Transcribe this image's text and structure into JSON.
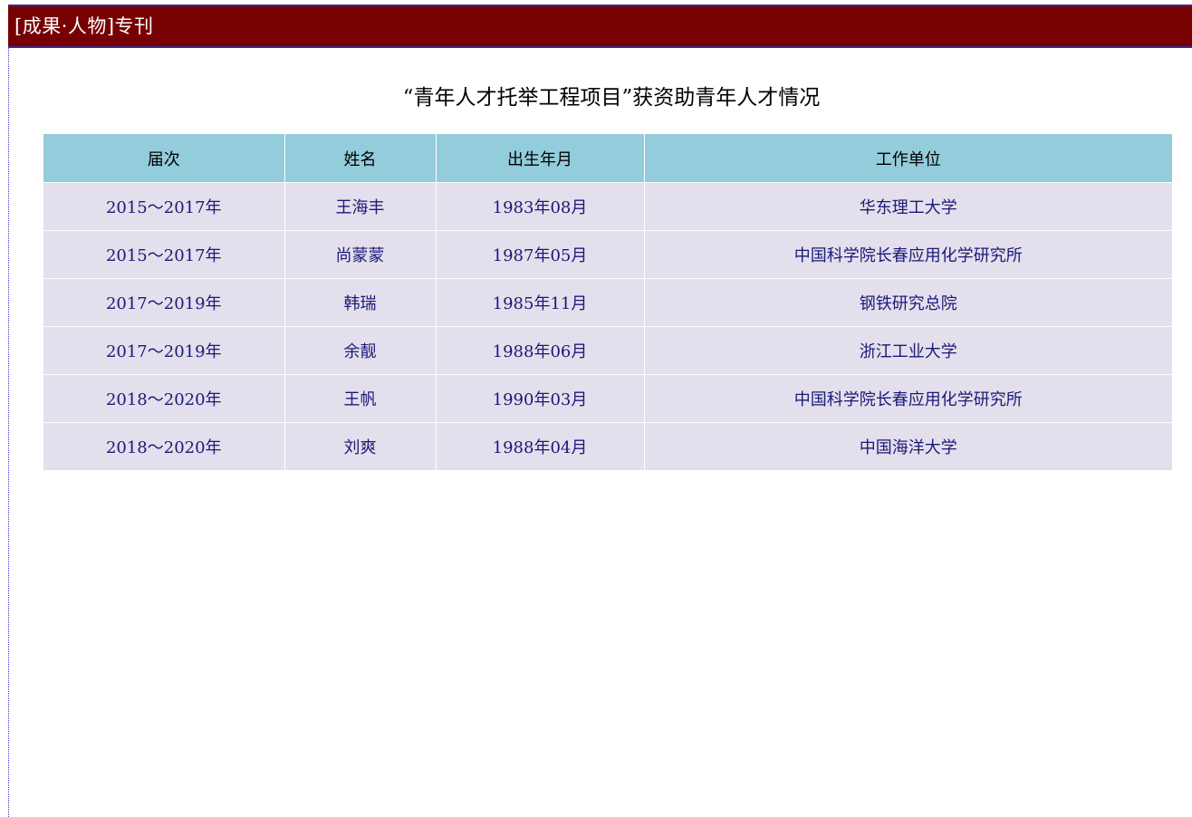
{
  "header": {
    "title": "[成果·人物]专刊"
  },
  "document": {
    "title": "“青年人才托举工程项目”获资助青年人才情况"
  },
  "table": {
    "columns": [
      "届次",
      "姓名",
      "出生年月",
      "工作单位"
    ],
    "rows": [
      [
        "2015～2017年",
        "王海丰",
        "1983年08月",
        "华东理工大学"
      ],
      [
        "2015～2017年",
        "尚蒙蒙",
        "1987年05月",
        "中国科学院长春应用化学研究所"
      ],
      [
        "2017～2019年",
        "韩瑞",
        "1985年11月",
        "钢铁研究总院"
      ],
      [
        "2017～2019年",
        "余靓",
        "1988年06月",
        "浙江工业大学"
      ],
      [
        "2018～2020年",
        "王帆",
        "1990年03月",
        "中国科学院长春应用化学研究所"
      ],
      [
        "2018～2020年",
        "刘爽",
        "1988年04月",
        "中国海洋大学"
      ]
    ]
  },
  "colors": {
    "header_bg": "#770000",
    "table_header_bg": "#93ccdb",
    "table_row_bg": "#e4dfec",
    "cell_text": "#1a1a78"
  }
}
